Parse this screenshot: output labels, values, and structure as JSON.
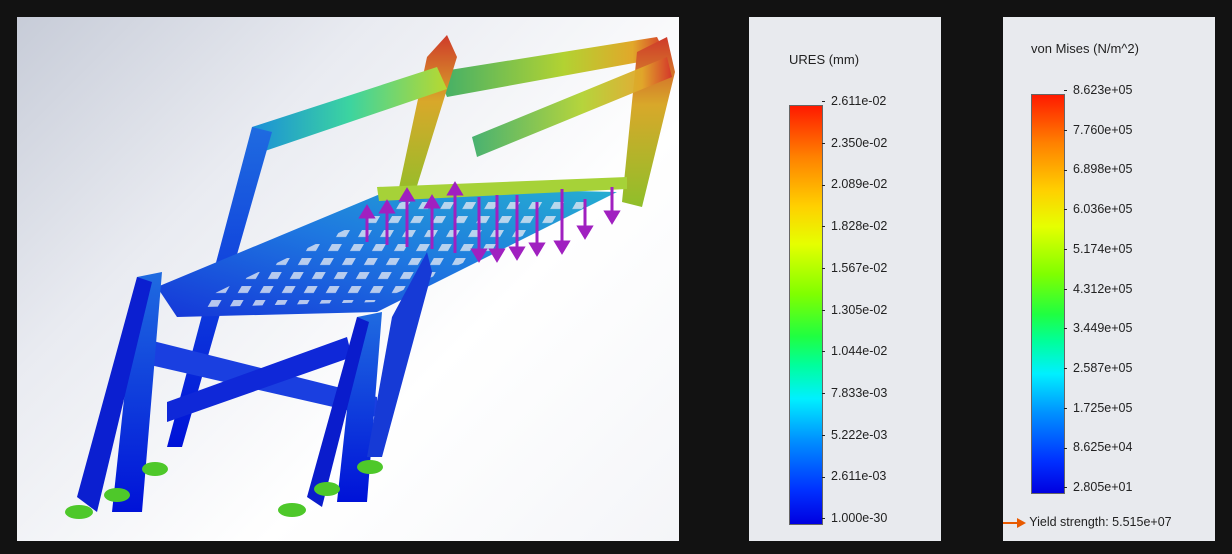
{
  "ures_legend": {
    "title": "URES (mm)",
    "ticks": [
      "2.611e-02",
      "2.350e-02",
      "2.089e-02",
      "1.828e-02",
      "1.567e-02",
      "1.305e-02",
      "1.044e-02",
      "7.833e-03",
      "5.222e-03",
      "2.611e-03",
      "1.000e-30"
    ]
  },
  "vm_legend": {
    "title": "von Mises (N/m^2)",
    "ticks": [
      "8.623e+05",
      "7.760e+05",
      "6.898e+05",
      "6.036e+05",
      "5.174e+05",
      "4.312e+05",
      "3.449e+05",
      "2.587e+05",
      "1.725e+05",
      "8.625e+04",
      "2.805e+01"
    ],
    "yield_label": "Yield strength: 5.515e+07"
  },
  "colors": {
    "load_arrow": "#a020c0",
    "fixture": "#4ec82a",
    "yield_arrow": "#e85a00"
  }
}
